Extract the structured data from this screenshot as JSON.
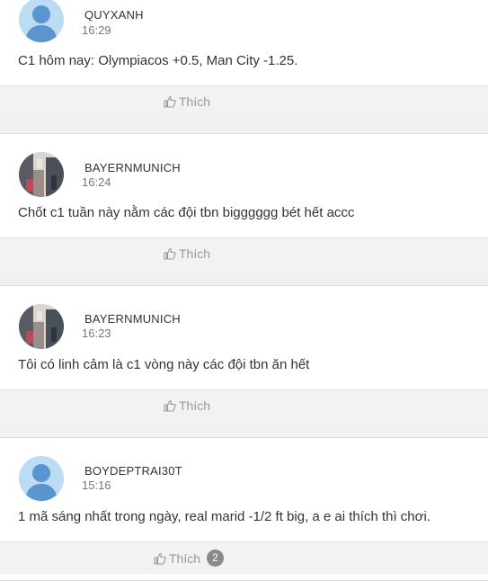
{
  "posts": [
    {
      "username": "QUYXANH",
      "time": "16:29",
      "content": "C1 hôm nay: Olympiacos +0.5, Man City -1.25.",
      "avatar": "default",
      "like_label": "Thích",
      "like_count": ""
    },
    {
      "username": "BAYERNMUNICH",
      "time": "16:24",
      "content": "Chốt c1 tuần này nằm các đội tbn bigggggg bét hết accc",
      "avatar": "photo",
      "like_label": "Thích",
      "like_count": ""
    },
    {
      "username": "BAYERNMUNICH",
      "time": "16:23",
      "content": "Tôi có linh cảm là c1 vòng này các đội tbn ăn hết",
      "avatar": "photo",
      "like_label": "Thích",
      "like_count": ""
    },
    {
      "username": "BOYDEPTRAI30T",
      "time": "15:16",
      "content": "1 mã sáng nhất trong ngày, real marid -1/2 ft big, a e ai thích thì chơi.",
      "avatar": "default",
      "like_label": "Thích",
      "like_count": "2"
    }
  ],
  "colors": {
    "avatar_default_bg": "#bcdcf3",
    "avatar_silhouette": "#5b95cf",
    "like_text": "#999999",
    "badge_bg": "#8a8a8a"
  }
}
